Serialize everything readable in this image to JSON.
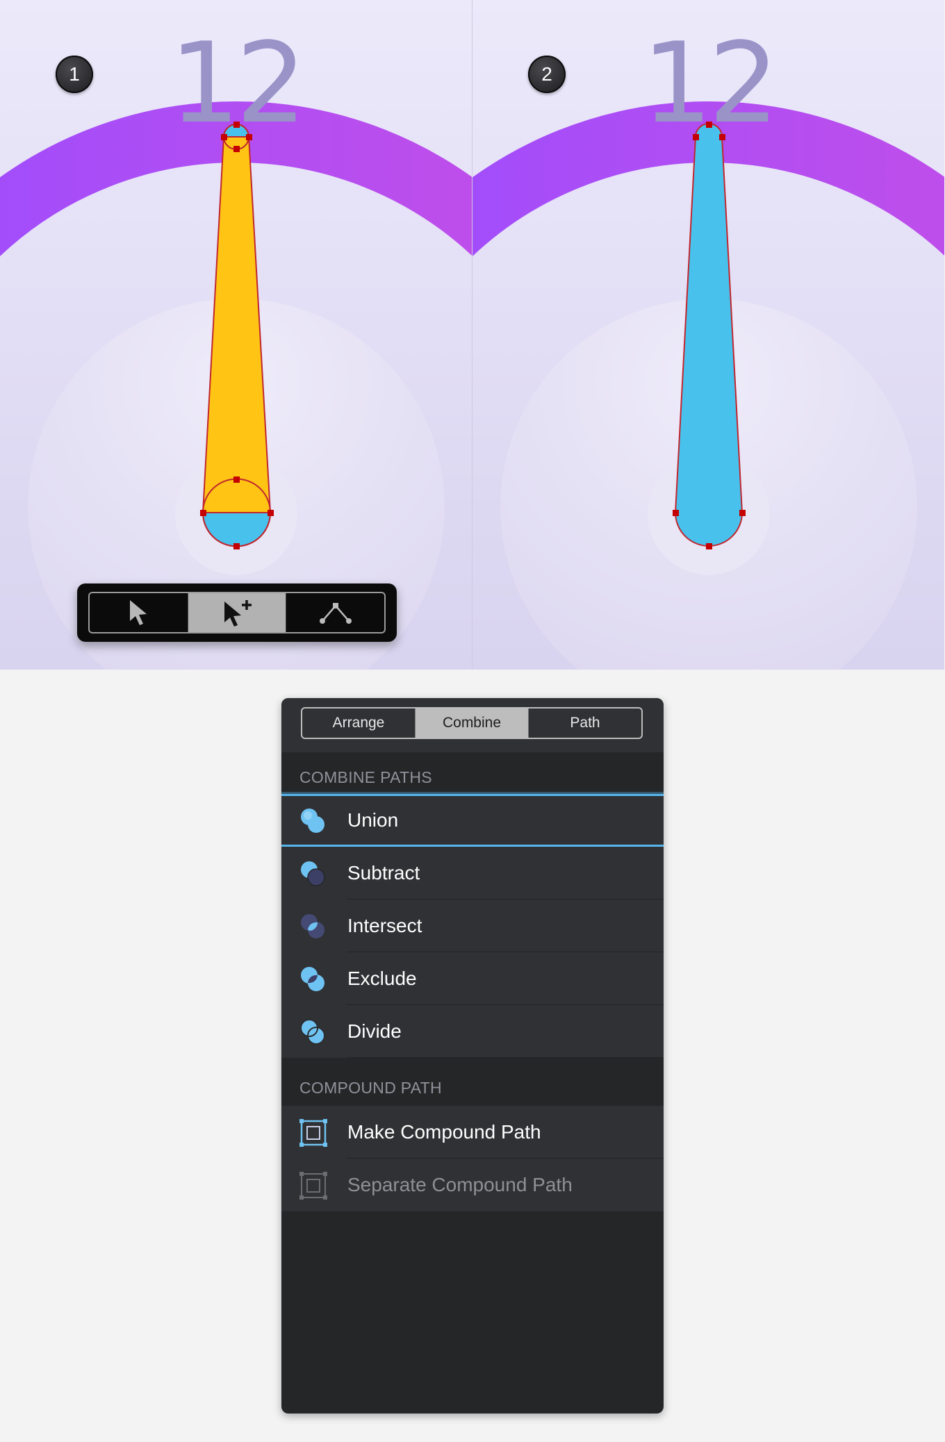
{
  "steps": [
    {
      "badge": "1",
      "hour_label": "12"
    },
    {
      "badge": "2",
      "hour_label": "12"
    }
  ],
  "tool_selector": {
    "tools": [
      {
        "name": "select-tool",
        "icon": "arrow-cursor-icon",
        "active": false
      },
      {
        "name": "select-add-tool",
        "icon": "arrow-plus-cursor-icon",
        "active": true
      },
      {
        "name": "node-tool",
        "icon": "node-path-icon",
        "active": false
      }
    ]
  },
  "colors": {
    "arc_gradient": [
      "#9b4dff",
      "#c64ee6"
    ],
    "hand_yellow": "#ffc414",
    "hand_cyan": "#48c2ec",
    "anchor_red": "#c40000",
    "path_stroke": "#c0262e",
    "hour_text": "#9a93c8",
    "background_top": "#ece9fb",
    "background_bottom": "#d6d1ee"
  },
  "inspector": {
    "tabs": [
      "Arrange",
      "Combine",
      "Path"
    ],
    "active_tab": "Combine",
    "combine_section": {
      "header": "COMBINE PATHS",
      "items": [
        {
          "label": "Union",
          "icon": "union-icon",
          "selected": true
        },
        {
          "label": "Subtract",
          "icon": "subtract-icon"
        },
        {
          "label": "Intersect",
          "icon": "intersect-icon"
        },
        {
          "label": "Exclude",
          "icon": "exclude-icon"
        },
        {
          "label": "Divide",
          "icon": "divide-icon"
        }
      ]
    },
    "compound_section": {
      "header": "COMPOUND PATH",
      "items": [
        {
          "label": "Make Compound Path",
          "icon": "make-compound-path-icon",
          "enabled": true
        },
        {
          "label": "Separate Compound Path",
          "icon": "separate-compound-path-icon",
          "enabled": false
        }
      ]
    }
  }
}
